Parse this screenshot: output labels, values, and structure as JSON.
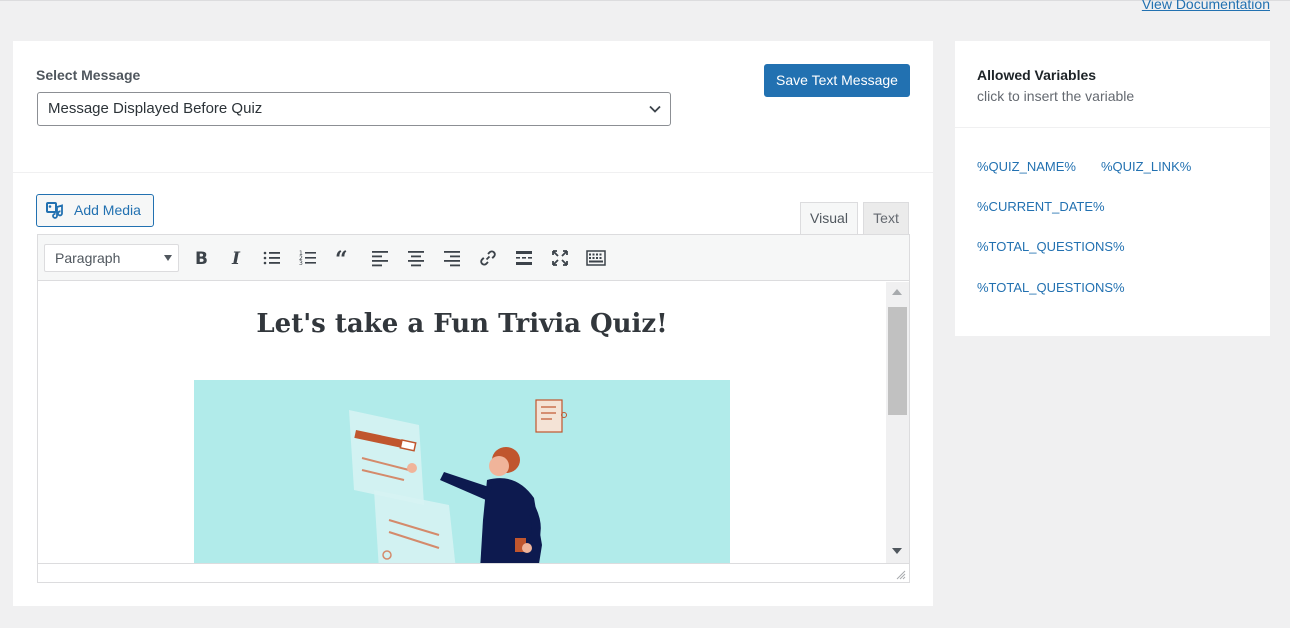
{
  "header": {
    "view_documentation": "View Documentation"
  },
  "message_panel": {
    "select_label": "Select Message",
    "selected_message": "Message Displayed Before Quiz",
    "save_button": "Save Text Message"
  },
  "editor": {
    "add_media": "Add Media",
    "tabs": {
      "visual": "Visual",
      "text": "Text"
    },
    "format_select": "Paragraph",
    "toolbar_icons": [
      "bold-icon",
      "italic-icon",
      "bullet-list-icon",
      "numbered-list-icon",
      "blockquote-icon",
      "align-left-icon",
      "align-center-icon",
      "align-right-icon",
      "link-icon",
      "read-more-icon",
      "fullscreen-icon",
      "toolbar-toggle-icon"
    ],
    "content_heading": "Let's take a Fun Trivia Quiz!"
  },
  "side_panel": {
    "title": "Allowed Variables",
    "subtitle": "click to insert the variable",
    "variables": [
      "%QUIZ_NAME%",
      "%QUIZ_LINK%",
      "%CURRENT_DATE%",
      "%TOTAL_QUESTIONS%",
      "%TOTAL_QUESTIONS%"
    ]
  },
  "colors": {
    "accent": "#2271b1",
    "illustration_bg": "#b1ebea"
  }
}
